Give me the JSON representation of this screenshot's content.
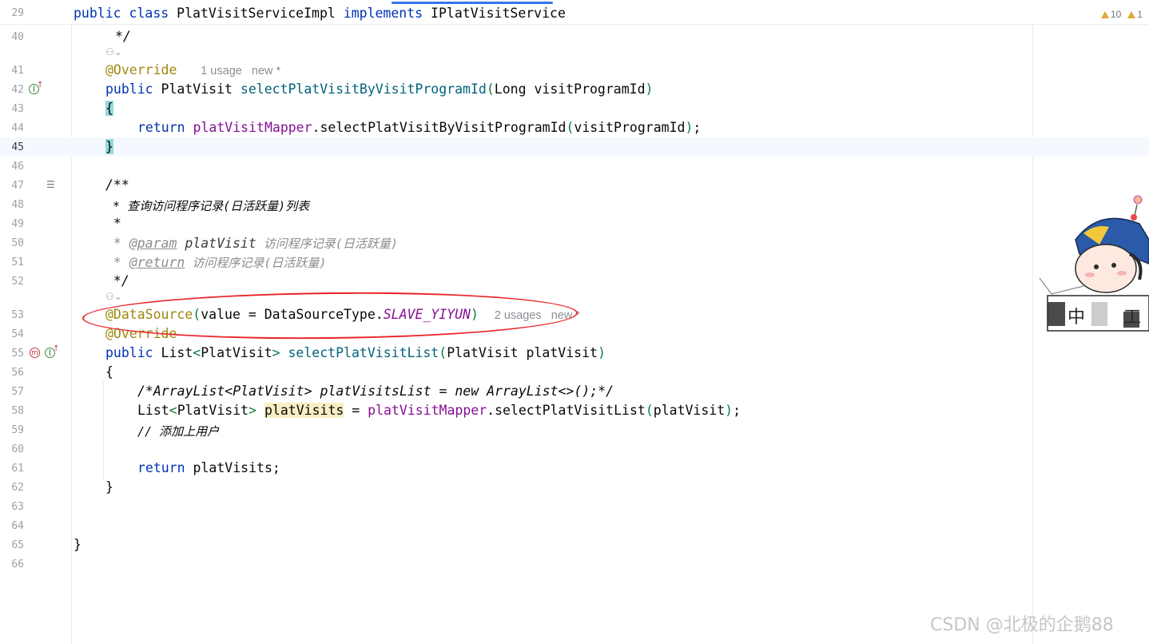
{
  "sticky_header": {
    "line_number": "29",
    "code": {
      "kw1": "public class",
      "name": " PlatVisitServiceImpl ",
      "kw2": "implements",
      "iface": " IPlatVisitService"
    },
    "warnings_count": "10",
    "weak_warnings_count": "1"
  },
  "lines": {
    "l40": {
      "n": "40",
      "text": "*/"
    },
    "l41": {
      "n": "41",
      "ann": "@Override",
      "hint": "1 usage   new *"
    },
    "l42": {
      "n": "42",
      "kw": "public",
      "type": " PlatVisit ",
      "fn": "selectPlatVisitByVisitProgramId",
      "p1": "(",
      "args": "Long visitProgramId",
      "p2": ")"
    },
    "l43": {
      "n": "43",
      "brace": "{"
    },
    "l44": {
      "n": "44",
      "kw": "return",
      "field": "platVisitMapper",
      "call": ".selectPlatVisitByVisitProgramId",
      "p1": "(",
      "arg": "visitProgramId",
      "p2": ")",
      "semi": ";"
    },
    "l45": {
      "n": "45",
      "brace": "}"
    },
    "l46": {
      "n": "46"
    },
    "l47": {
      "n": "47",
      "text": "/**"
    },
    "l48": {
      "n": "48",
      "text": " * 查询访问程序记录(日活跃量)列表"
    },
    "l49": {
      "n": "49",
      "text": " *"
    },
    "l50": {
      "n": "50",
      "pre": " * ",
      "tag": "@param",
      "pname": " platVisit",
      "desc": " 访问程序记录(日活跃量)"
    },
    "l51": {
      "n": "51",
      "pre": " * ",
      "tag": "@return",
      "desc": " 访问程序记录(日活跃量)"
    },
    "l52": {
      "n": "52",
      "text": " */"
    },
    "l53": {
      "n": "53",
      "ann": "@DataSource",
      "p1": "(",
      "mid": "value = DataSourceType.",
      "const": "SLAVE_YIYUN",
      "p2": ")",
      "hint": "2 usages   new *"
    },
    "l54": {
      "n": "54",
      "ann": "@Override"
    },
    "l55": {
      "n": "55",
      "kw": "public",
      "t1": " List",
      "lt": "<",
      "t2": "PlatVisit",
      "gt": ">",
      "sp": " ",
      "fn": "selectPlatVisitList",
      "p1": "(",
      "args": "PlatVisit platVisit",
      "p2": ")"
    },
    "l56": {
      "n": "56",
      "brace": "{"
    },
    "l57": {
      "n": "57",
      "text": "/*ArrayList<PlatVisit> platVisitsList = new ArrayList<>();*/"
    },
    "l58": {
      "n": "58",
      "t1": "List",
      "lt": "<",
      "t2": "PlatVisit",
      "gt": ">",
      "sp": " ",
      "var": "platVisits",
      "eq": " = ",
      "field": "platVisitMapper",
      "call": ".selectPlatVisitList",
      "p1": "(",
      "arg": "platVisit",
      "p2": ")",
      "semi": ";"
    },
    "l59": {
      "n": "59",
      "text": "// 添加上用户"
    },
    "l60": {
      "n": "60"
    },
    "l61": {
      "n": "61",
      "kw": "return",
      "rest": " platVisits;"
    },
    "l62": {
      "n": "62",
      "brace": "}"
    },
    "l63": {
      "n": "63"
    },
    "l64": {
      "n": "64"
    },
    "l65": {
      "n": "65",
      "brace": "}"
    },
    "l66": {
      "n": "66"
    }
  },
  "watermark": "CSDN @北极的企鹅88",
  "sticker_chars": [
    "中",
    "工"
  ]
}
